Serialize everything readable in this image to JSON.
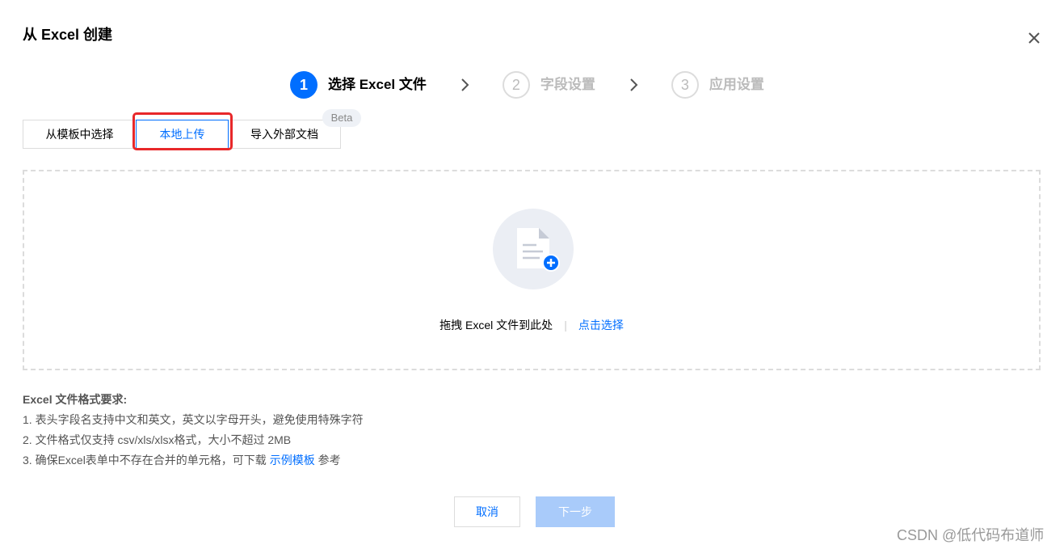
{
  "dialog": {
    "title": "从 Excel 创建",
    "close_icon": "close-icon"
  },
  "steps": [
    {
      "number": "1",
      "label": "选择 Excel 文件",
      "state": "active"
    },
    {
      "number": "2",
      "label": "字段设置",
      "state": "inactive"
    },
    {
      "number": "3",
      "label": "应用设置",
      "state": "inactive"
    }
  ],
  "tabs": {
    "items": [
      "从模板中选择",
      "本地上传",
      "导入外部文档"
    ],
    "selected": "本地上传",
    "beta_badge": "Beta"
  },
  "upload": {
    "icon": "file-add-icon",
    "drag_text": "拖拽 Excel 文件到此处",
    "separator": "|",
    "select_link": "点击选择"
  },
  "requirements": {
    "title": "Excel 文件格式要求:",
    "line1": "1. 表头字段名支持中文和英文，英文以字母开头，避免使用特殊字符",
    "line2": "2. 文件格式仅支持 csv/xls/xlsx格式，大小不超过 2MB",
    "line3_prefix": "3. 确保Excel表单中不存在合并的单元格，可下载",
    "line3_link": "示例模板",
    "line3_suffix": "参考"
  },
  "buttons": {
    "cancel": "取消",
    "next": "下一步"
  },
  "watermark": "CSDN @低代码布道师",
  "colors": {
    "primary": "#006eff",
    "disabled_primary": "#a9cbfa",
    "highlight": "#e8282a"
  }
}
